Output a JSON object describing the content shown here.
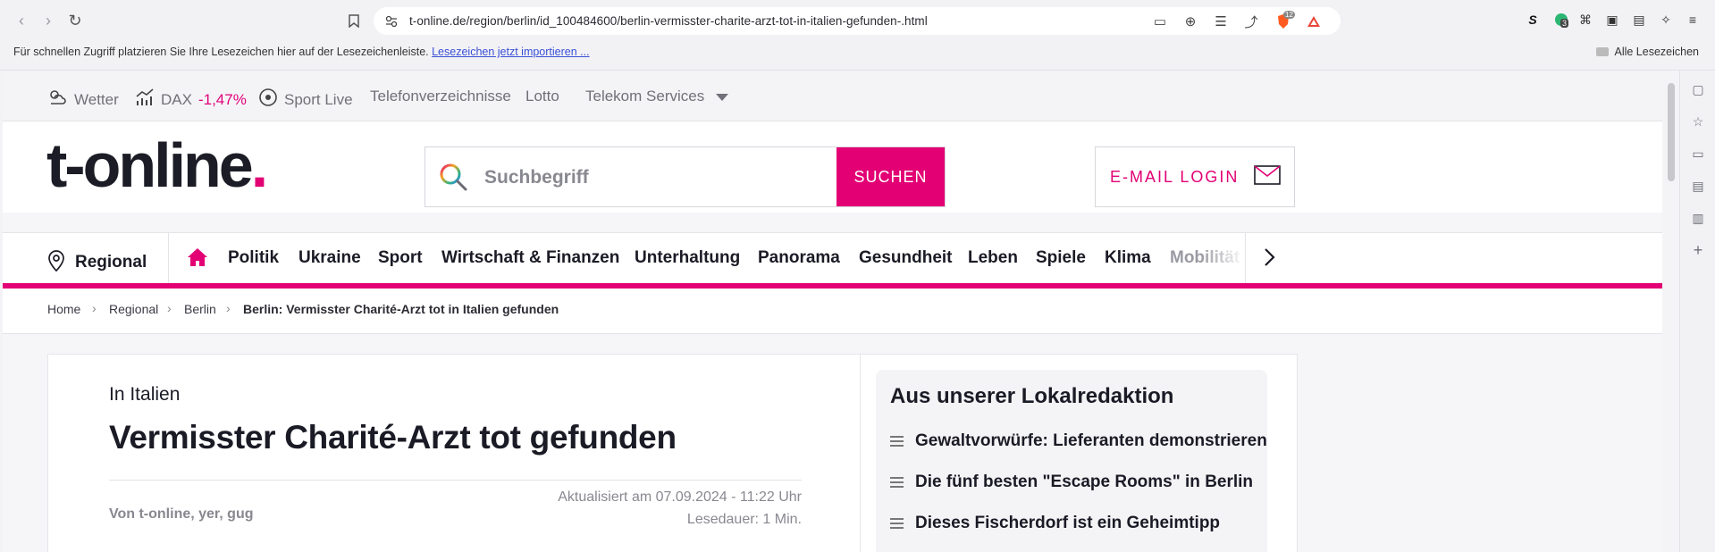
{
  "browser": {
    "url": "t-online.de/region/berlin/id_100484600/berlin-vermisster-charite-arzt-tot-in-italien-gefunden-.html",
    "bookmarks_hint": "Für schnellen Zugriff platzieren Sie Ihre Lesezeichen hier auf der Lesezeichenleiste.",
    "bookmarks_import": "Lesezeichen jetzt importieren ...",
    "all_bookmarks": "Alle Lesezeichen",
    "brave_badge": "12",
    "ext_badge": "3"
  },
  "services": {
    "weather": "Wetter",
    "dax_label": "DAX",
    "dax_value": "-1,47%",
    "sport_live": "Sport Live",
    "phone": "Telefonverzeichnisse",
    "lotto": "Lotto",
    "telekom": "Telekom Services"
  },
  "header": {
    "logo_text": "t-online",
    "logo_dot": ".",
    "search_placeholder": "Suchbegriff",
    "search_button": "SUCHEN",
    "email_login": "E-MAIL LOGIN"
  },
  "nav": {
    "regional": "Regional",
    "items": [
      "Politik",
      "Ukraine",
      "Sport",
      "Wirtschaft & Finanzen",
      "Unterhaltung",
      "Panorama",
      "Gesundheit",
      "Leben",
      "Spiele",
      "Klima",
      "Mobilität"
    ]
  },
  "breadcrumb": {
    "home": "Home",
    "regional": "Regional",
    "berlin": "Berlin",
    "current": "Berlin: Vermisster Charité-Arzt tot in Italien gefunden"
  },
  "article": {
    "kicker": "In Italien",
    "headline": "Vermisster Charité-Arzt tot gefunden",
    "author": "Von t-online, yer, gug",
    "updated": "Aktualisiert am 07.09.2024 - 11:22 Uhr",
    "read_time": "Lesedauer: 1 Min."
  },
  "sidebar": {
    "title": "Aus unserer Lokalredaktion",
    "items": [
      "Gewaltvorwürfe: Lieferanten demonstrieren",
      "Die fünf besten \"Escape Rooms\" in Berlin",
      "Dieses Fischerdorf ist ein Geheimtipp"
    ]
  },
  "colors": {
    "brand": "#e20074",
    "text": "#1b1b26",
    "muted": "#888890"
  }
}
